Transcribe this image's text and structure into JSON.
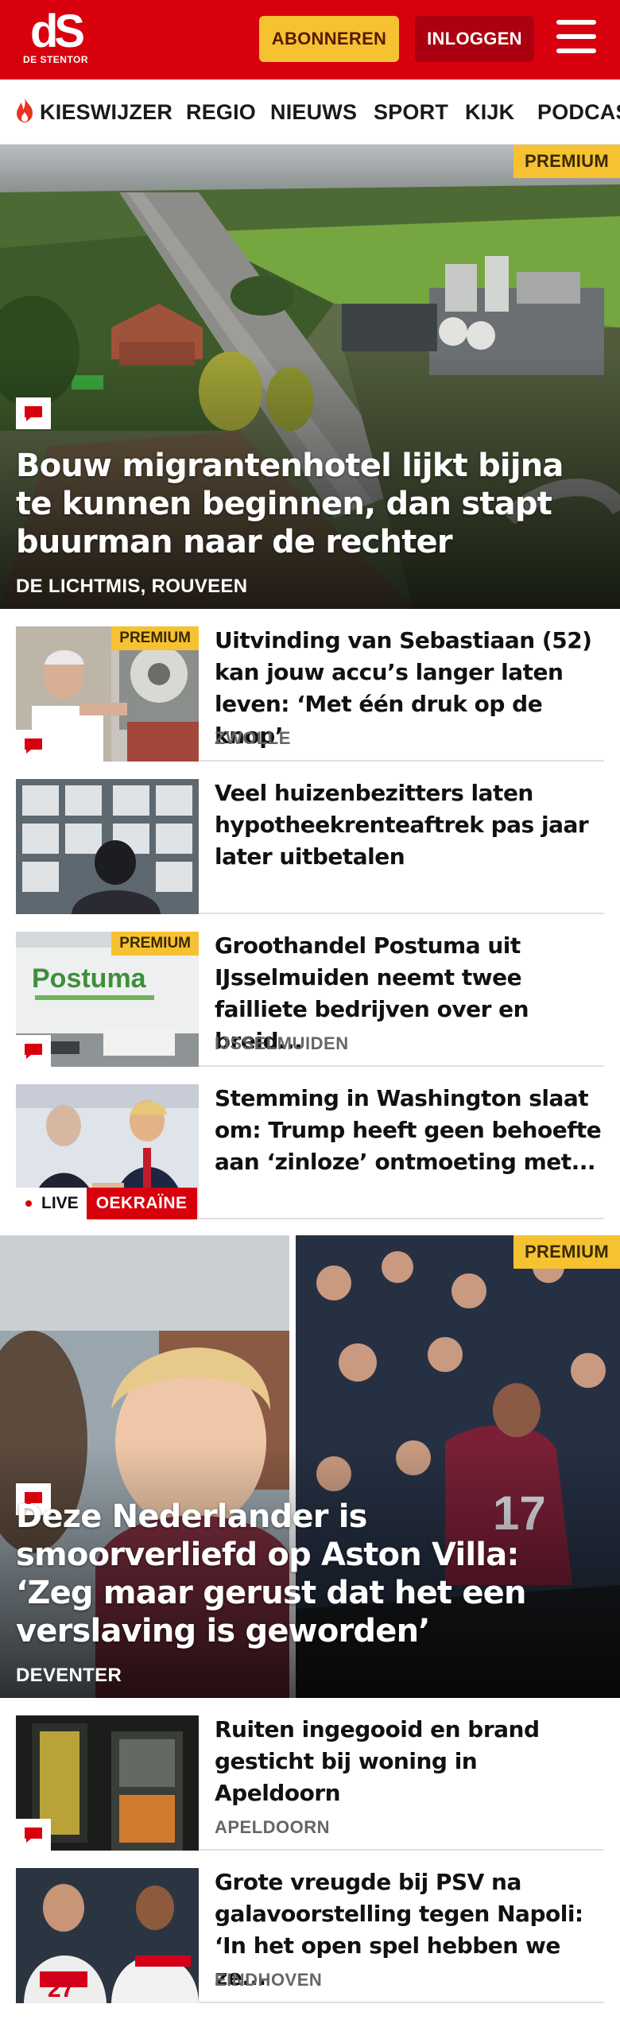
{
  "header": {
    "logo_mark": "dS",
    "logo_name": "DE STENTOR",
    "subscribe_label": "ABONNEREN",
    "login_label": "INLOGGEN",
    "menu_icon": "hamburger-icon",
    "brand_color": "#d9000d",
    "accent_color": "#f6c232"
  },
  "nav": {
    "items": [
      {
        "label": "KIESWIJZER",
        "icon": "flame-icon"
      },
      {
        "label": "REGIO"
      },
      {
        "label": "NIEUWS"
      },
      {
        "label": "SPORT"
      },
      {
        "label": "KIJK"
      },
      {
        "label": "PODCAS"
      }
    ]
  },
  "hero1": {
    "badge": "PREMIUM",
    "title": "Bouw migrantenhotel lijkt bijna te kunnen beginnen, dan stapt buurman naar de rechter",
    "location": "DE LICHTMIS, ROUVEEN",
    "comment_icon": "comment-icon"
  },
  "articles": [
    {
      "title": "Uitvinding van Sebastiaan (52) kan jouw accu’s langer laten leven: ‘Met één druk op de knop’",
      "location": "ZWOLLE",
      "badge": "PREMIUM"
    },
    {
      "title": "Veel huizenbezitters laten hypotheekrenteaftrek pas jaar later uitbetalen",
      "location": ""
    },
    {
      "title": "Groothandel Postuma uit IJsselmuiden neemt twee failliete bedrijven over en breid...",
      "location": "IJSSELMUIDEN",
      "badge": "PREMIUM"
    },
    {
      "title": "Stemming in Washington slaat om: Trump heeft geen behoefte aan ‘zinloze’ ontmoeting met...",
      "location": "",
      "live_label": "LIVE",
      "tag": "OEKRAÏNE"
    }
  ],
  "hero2": {
    "badge": "PREMIUM",
    "title": "Deze Nederlander is smoorverliefd op Aston Villa: ‘Zeg maar gerust dat het een verslaving is geworden’",
    "location": "DEVENTER",
    "comment_icon": "comment-icon"
  },
  "articles2": [
    {
      "title": "Ruiten ingegooid en brand gesticht bij woning in Apeldoorn",
      "location": "APELDOORN"
    },
    {
      "title": "Grote vreugde bij PSV na galavoorstelling tegen Napoli: ‘In het open spel hebben we ze...",
      "location": "EINDHOVEN"
    }
  ]
}
